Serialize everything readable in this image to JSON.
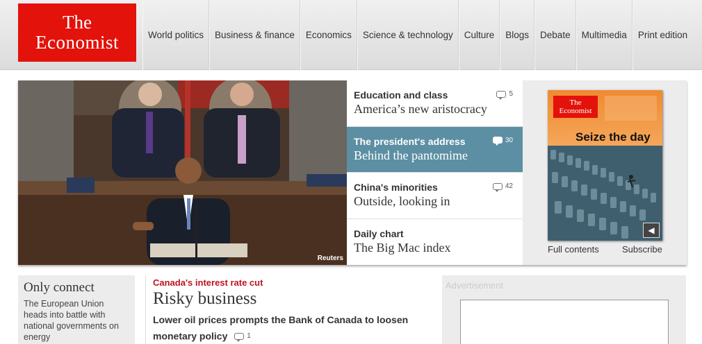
{
  "logo": {
    "line1": "The",
    "line2": "Economist"
  },
  "nav": [
    "World politics",
    "Business & finance",
    "Economics",
    "Science & technology",
    "Culture",
    "Blogs",
    "Debate",
    "Multimedia",
    "Print edition"
  ],
  "hero": {
    "credit": "Reuters"
  },
  "stories": [
    {
      "kicker": "Education and class",
      "headline": "America’s new aristocracy",
      "comments": "5",
      "active": false
    },
    {
      "kicker": "The president's address",
      "headline": "Behind the pantomime",
      "comments": "30",
      "active": true
    },
    {
      "kicker": "China's minorities",
      "headline": "Outside, looking in",
      "comments": "42",
      "active": false
    },
    {
      "kicker": "Daily chart",
      "headline": "The Big Mac index",
      "comments": "",
      "active": false
    }
  ],
  "cover": {
    "logo_line1": "The",
    "logo_line2": "Economist",
    "title": "Seize the day",
    "full_contents": "Full contents",
    "subscribe": "Subscribe"
  },
  "only_connect": {
    "title": "Only connect",
    "desc": "The European Union heads into battle with national governments on energy"
  },
  "feature": {
    "kicker": "Canada's interest rate cut",
    "headline": "Risky business",
    "sub": "Lower oil prices prompts the Bank of Canada to loosen monetary policy",
    "comments": "1"
  },
  "ad": {
    "label": "Advertisement"
  },
  "colors": {
    "brand_red": "#e3120b",
    "active_blue": "#5c8fa3",
    "kicker_red": "#c0111f"
  }
}
